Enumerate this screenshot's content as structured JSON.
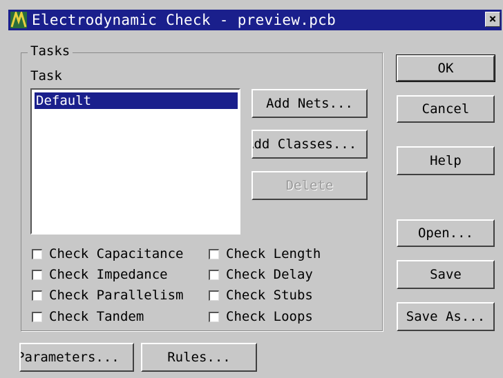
{
  "window": {
    "title": "Electrodynamic Check - preview.pcb",
    "icon": "app-icon",
    "close_glyph": "×"
  },
  "tasks_group": {
    "legend": "Tasks",
    "task_label": "Task",
    "list": [
      "Default"
    ],
    "selected": "Default"
  },
  "task_buttons": {
    "add_nets": "Add Nets...",
    "add_classes": "Add Classes...",
    "delete": "Delete"
  },
  "checks": {
    "capacitance": "Check Capacitance",
    "length": "Check Length",
    "impedance": "Check Impedance",
    "delay": "Check Delay",
    "parallelism": "Check Parallelism",
    "stubs": "Check Stubs",
    "tandem": "Check Tandem",
    "loops": "Check Loops"
  },
  "bottom_buttons": {
    "parameters": "Parameters...",
    "rules": "Rules..."
  },
  "side_buttons": {
    "ok": "OK",
    "cancel": "Cancel",
    "help": "Help",
    "open": "Open...",
    "save": "Save",
    "save_as": "Save As..."
  }
}
